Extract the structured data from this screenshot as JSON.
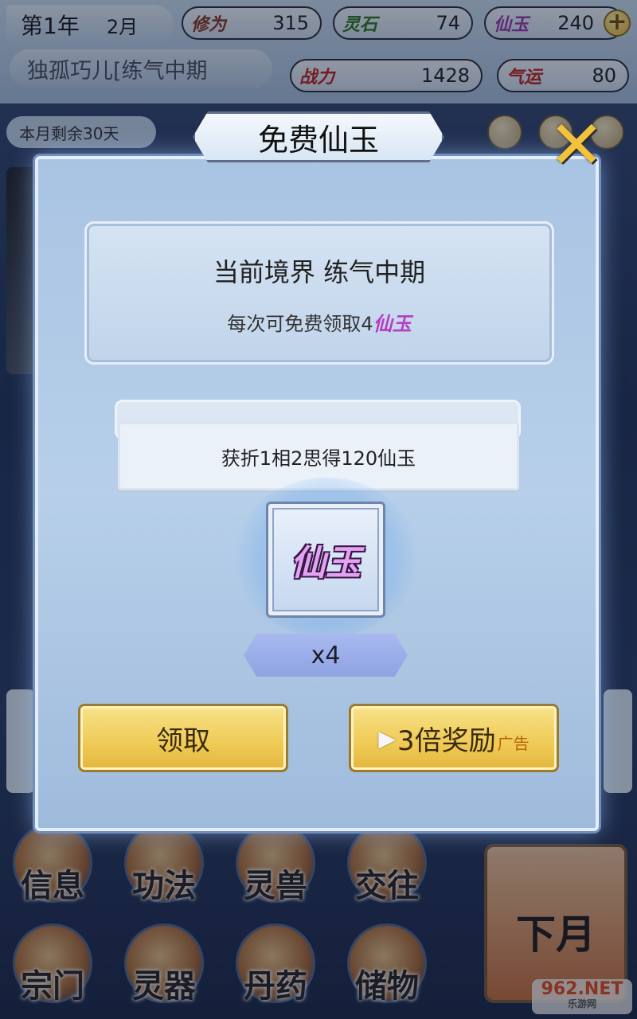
{
  "status": {
    "year": "第1年",
    "month": "2月",
    "cultivation_label": "修为",
    "cultivation_value": "315",
    "spirit_stone_label": "灵石",
    "spirit_stone_value": "74",
    "jade_label": "仙玉",
    "jade_value": "240",
    "character": "独孤巧儿[练气中期",
    "power_label": "战力",
    "power_value": "1428",
    "luck_label": "气运",
    "luck_value": "80",
    "remaining": "本月剩余30天"
  },
  "dialog": {
    "title": "免费仙玉",
    "realm_title": "当前境界 练气中期",
    "realm_desc": "每次可免费领取4",
    "realm_desc_item": "仙玉",
    "tip": "获折1相2思得120仙玉",
    "reward_name": "仙玉",
    "reward_qty": "x4",
    "claim_label": "领取",
    "triple_label": "3倍奖励",
    "triple_ad": "广告"
  },
  "nav": {
    "items": [
      "信息",
      "功法",
      "灵兽",
      "交往",
      "宗门",
      "灵器",
      "丹药",
      "储物"
    ],
    "next_month": "下月"
  },
  "colors": {
    "accent_gold": "#efca55",
    "jade_purple": "#b63cc2",
    "dialog_bg": "#b7cfe9"
  }
}
